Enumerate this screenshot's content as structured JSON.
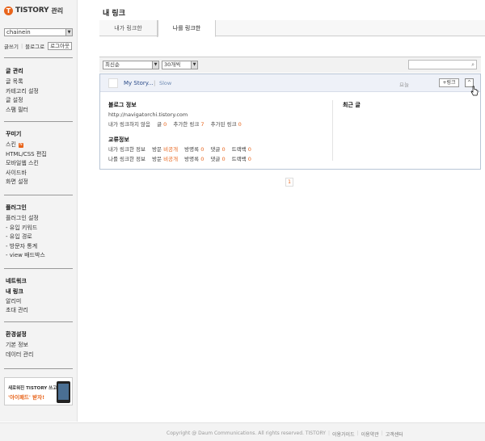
{
  "app": {
    "logo_letter": "T",
    "logo_text": "TISTORY",
    "logo_sub": "관리"
  },
  "sidebar": {
    "blog_select": "chainein",
    "top_links": [
      "글쓰기",
      "블로그로"
    ],
    "logout_label": "로그아웃",
    "sections": [
      {
        "title": "글 관리",
        "items": [
          "글 목록",
          "카테고리 설정",
          "글 설정",
          "스팸 필터"
        ]
      },
      {
        "title": "꾸미기",
        "items": [
          "스킨",
          "HTML/CSS 편집",
          "모바일웹 스킨",
          "사이드바",
          "화면 설정"
        ],
        "badge": "N"
      },
      {
        "title": "플러그인",
        "items": [
          "플러그인 설정",
          "- 유입 키워드",
          "- 유입 경로",
          "- 방문자 통계",
          "- view 배드박스"
        ]
      },
      {
        "title": "네트워크",
        "items": [
          "내 링크",
          "알리미",
          "초대 관리"
        ],
        "active": "내 링크"
      },
      {
        "title": "환경설정",
        "items": [
          "기본 정보",
          "데이터 관리"
        ]
      }
    ],
    "banner": {
      "line1": "새로워진 TISTORY 쓰고",
      "line2": "'아이패드' 받자!"
    }
  },
  "main": {
    "title": "내 링크",
    "tabs": [
      "내가 링크한",
      "나를 링크한"
    ],
    "active_tab": "나를 링크한",
    "filters": {
      "sort": "최신순",
      "count": "30개씩"
    },
    "card": {
      "name": "My Story...",
      "tag": "Slow",
      "status": "요늘",
      "add_link_label": "+링크",
      "collapse_icon": "^",
      "blog_info_title": "블로그 정보",
      "blog_url": "http://navigatorchi.tistory.com",
      "stats": {
        "not_linked_label": "내가 링크하지 않음",
        "posts_label": "글",
        "posts": "0",
        "added_label": "추가한 링크",
        "added": "7",
        "added_by_label": "추가된 링크",
        "added_by": "0"
      },
      "exchange_title": "교류정보",
      "rows": [
        {
          "label": "내가 링크한 정보",
          "visit_label": "방문",
          "visit": "비공개",
          "guestbook_label": "방명록",
          "guestbook": "0",
          "comment_label": "댓글",
          "comment": "0",
          "trackback_label": "트랙백",
          "trackback": "0"
        },
        {
          "label": "나를 링크한 정보",
          "visit_label": "방문",
          "visit": "비공개",
          "guestbook_label": "방명록",
          "guestbook": "0",
          "comment_label": "댓글",
          "comment": "0",
          "trackback_label": "트랙백",
          "trackback": "0"
        }
      ],
      "recent_title": "최근 글"
    },
    "pagination": {
      "current": "1"
    }
  },
  "footer": {
    "copyright": "Copyright @ Daum Communications. All rights reserved. TISTORY",
    "links": [
      "이용가이드",
      "이용약관",
      "고객센터"
    ]
  }
}
